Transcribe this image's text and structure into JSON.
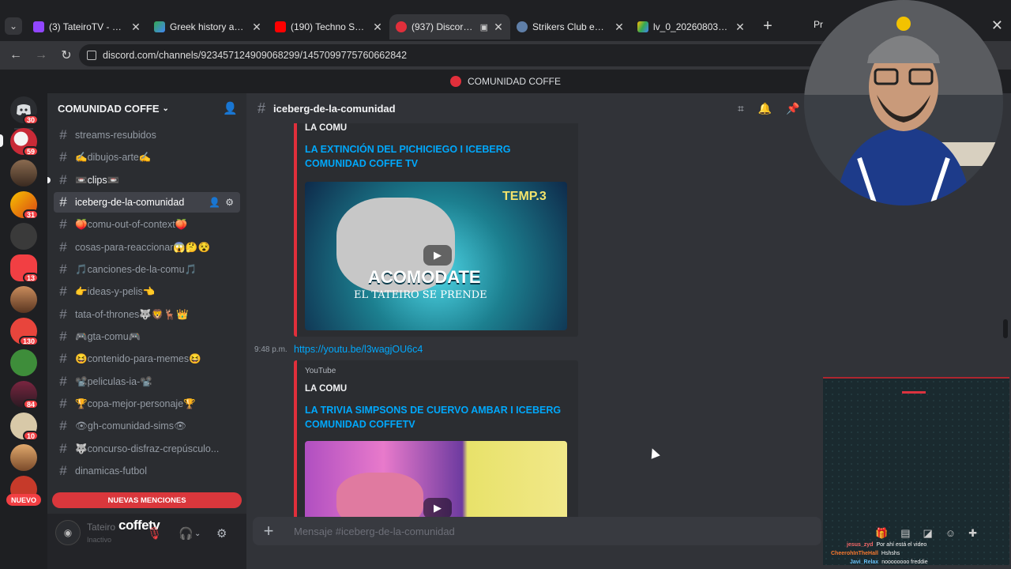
{
  "browser": {
    "tabs": [
      {
        "title": "(3) TateiroTV - Produ",
        "icon_color": "#9146ff"
      },
      {
        "title": "Greek history and mi",
        "icon_color": "#34a853"
      },
      {
        "title": "(190) Techno Syndror",
        "icon_color": "#ff0000"
      },
      {
        "title": "(937) Discord | #",
        "icon_color": "#e12f3b",
        "active": true
      },
      {
        "title": "Strikers Club en Stea",
        "icon_color": "#5f7fa8"
      },
      {
        "title": "lv_0_20260803184631",
        "icon_color": "#fbbc04"
      }
    ],
    "partial_tab": "Pr",
    "url": "discord.com/channels/923457124909068299/1457099775760662842",
    "new_tab": "+",
    "close": "✕"
  },
  "discord": {
    "top_title": "COMUNIDAD COFFE",
    "server_name": "COMUNIDAD COFFE",
    "channels": [
      {
        "label": "streams-resubidos"
      },
      {
        "label": "✍️dibujos-arte✍️"
      },
      {
        "label": "📼clips📼",
        "bold": true,
        "unread": true
      },
      {
        "label": "iceberg-de-la-comunidad",
        "active": true
      },
      {
        "label": "🍑comu-out-of-context🍑"
      },
      {
        "label": "cosas-para-reaccionar😱🤔😵"
      },
      {
        "label": "🎵canciones-de-la-comu🎵"
      },
      {
        "label": "👉ideas-y-pelis👈"
      },
      {
        "label": "tata-of-thrones🐺🦁🦌👑"
      },
      {
        "label": "🎮gta-comu🎮"
      },
      {
        "label": "😆contenido-para-memes😆"
      },
      {
        "label": "📽️peliculas-ia-📽️"
      },
      {
        "label": "🏆copa-mejor-personaje🏆"
      },
      {
        "label": "👁gh-comunidad-sims👁"
      },
      {
        "label": "🐺concurso-disfraz-crepúsculo..."
      },
      {
        "label": "dinamicas-futbol"
      }
    ],
    "rail_badges": [
      "30",
      "59",
      "31",
      "13",
      "130",
      "84",
      "10"
    ],
    "nuevo": "NUEVO",
    "new_mentions": "NUEVAS MENCIONES",
    "user": {
      "name": "Tateiro",
      "status": "Inactivo",
      "overlay": "coffetv"
    },
    "channel_title": "iceberg-de-la-comunidad",
    "embeds": [
      {
        "author": "LA COMU",
        "title": "LA EXTINCIÓN DEL PICHICIEGO I ICEBERG COMUNIDAD COFFE TV"
      },
      {
        "timestamp": "9:48 p.m.",
        "link": "https://youtu.be/l3wagjOU6c4",
        "provider": "YouTube",
        "author": "LA COMU",
        "title": "LA TRIVIA SIMPSONS DE CUERVO AMBAR I ICEBERG COMUNIDAD COFFETV"
      }
    ],
    "thumbnail_1": {
      "badge": "TEMP.3",
      "headline": "ACOMODATE",
      "subline": "EL TATEIRO SE PRENDE"
    },
    "composer_placeholder": "Mensaje #iceberg-de-la-comunidad"
  },
  "stream_chat": [
    {
      "user": "jesus_zyd",
      "msg": "Por ahí está el video",
      "color": "#ff6b6b"
    },
    {
      "user": "CheerohInTheHall",
      "msg": "Hshshs",
      "color": "#ff7b2e"
    },
    {
      "user": "Javi_Relax",
      "msg": "noooooooo freddie",
      "color": "#6bc7ff"
    }
  ],
  "colors": {
    "accent": "#e12f3b",
    "link": "#00a8fc",
    "mention": "#da373c"
  }
}
